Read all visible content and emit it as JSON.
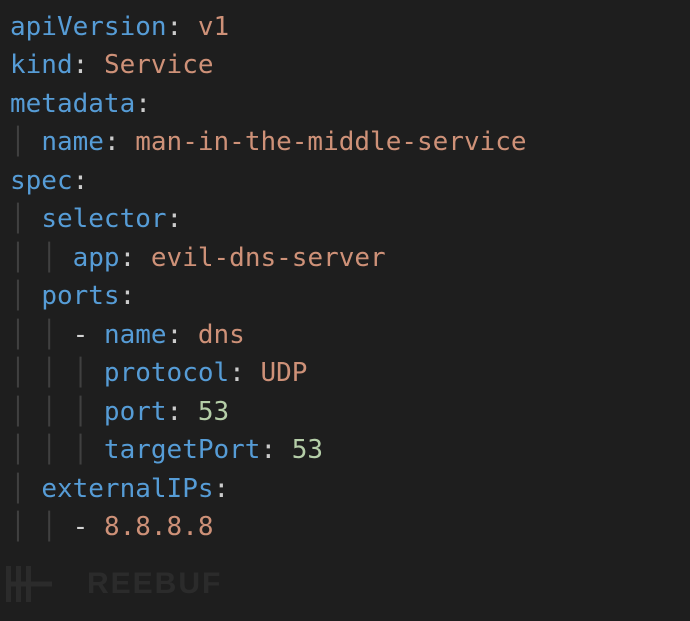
{
  "yaml": {
    "apiVersion": {
      "key": "apiVersion",
      "value": "v1"
    },
    "kind": {
      "key": "kind",
      "value": "Service"
    },
    "metadata": {
      "key": "metadata",
      "name": {
        "key": "name",
        "value": "man-in-the-middle-service"
      }
    },
    "spec": {
      "key": "spec",
      "selector": {
        "key": "selector",
        "app": {
          "key": "app",
          "value": "evil-dns-server"
        }
      },
      "ports": {
        "key": "ports",
        "item0": {
          "dash": "-",
          "name": {
            "key": "name",
            "value": "dns"
          },
          "protocol": {
            "key": "protocol",
            "value": "UDP"
          },
          "port": {
            "key": "port",
            "value": "53"
          },
          "targetPort": {
            "key": "targetPort",
            "value": "53"
          }
        }
      },
      "externalIPs": {
        "key": "externalIPs",
        "item0": {
          "dash": "-",
          "value": "8.8.8.8"
        }
      }
    }
  },
  "watermark": {
    "text": "REEBUF"
  }
}
